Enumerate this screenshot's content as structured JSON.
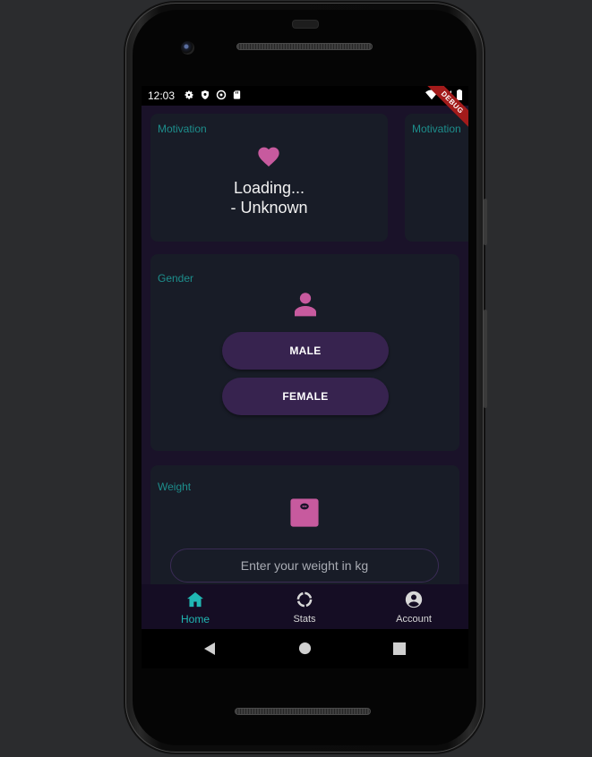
{
  "status_bar": {
    "time": "12:03",
    "left_icons": [
      "settings-icon",
      "shield-icon",
      "vpn-icon",
      "sd-card-icon"
    ],
    "right_icons": [
      "wifi-icon",
      "signal-icon",
      "battery-icon"
    ]
  },
  "debug_banner": "DEBUG",
  "motivation_cards": [
    {
      "label": "Motivation",
      "icon": "heart-icon",
      "quote": "Loading...",
      "author": "- Unknown"
    },
    {
      "label": "Motivation"
    }
  ],
  "gender_card": {
    "label": "Gender",
    "icon": "person-icon",
    "male_label": "MALE",
    "female_label": "FEMALE"
  },
  "weight_card": {
    "label": "Weight",
    "icon": "scale-icon",
    "input_placeholder": "Enter your weight in kg",
    "input_value": ""
  },
  "bottom_nav": {
    "items": [
      {
        "label": "Home",
        "icon": "home-icon",
        "active": true
      },
      {
        "label": "Stats",
        "icon": "stats-ring-icon",
        "active": false
      },
      {
        "label": "Account",
        "icon": "account-circle-icon",
        "active": false
      }
    ]
  },
  "system_nav": [
    "back-icon",
    "home-circle-icon",
    "recents-icon"
  ],
  "colors": {
    "background": "#1a1229",
    "card": "#181c27",
    "accent_teal": "#1d8e8c",
    "accent_pink": "#c75a9e",
    "button": "#37234f",
    "nav_active": "#20b7b3"
  }
}
